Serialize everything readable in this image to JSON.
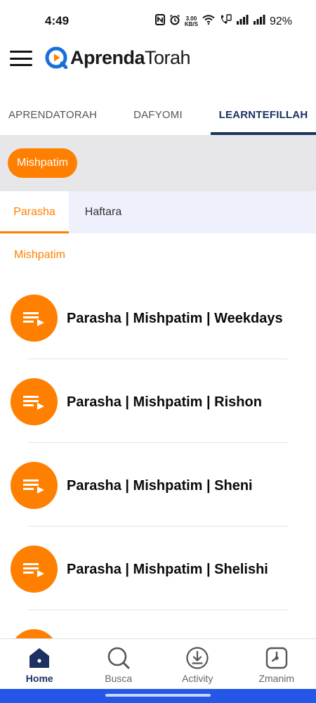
{
  "status_bar": {
    "time": "4:49",
    "net_speed_value": "3.00",
    "net_speed_unit": "KB/S",
    "battery": "92%"
  },
  "header": {
    "logo_bold": "Aprenda",
    "logo_light": "Torah",
    "brand_color": "#1a6fd6"
  },
  "top_tabs": [
    {
      "label": "APRENDATORAH",
      "active": false
    },
    {
      "label": "DAFYOMI",
      "active": false
    },
    {
      "label": "LEARNTEFILLAH",
      "active": true
    }
  ],
  "chip": {
    "label": "Mishpatim"
  },
  "sub_tabs": [
    {
      "label": "Parasha",
      "active": true
    },
    {
      "label": "Haftara",
      "active": false
    }
  ],
  "section_label": "Mishpatim",
  "items": [
    {
      "title": "Parasha | Mishpatim | Weekdays",
      "icon": "playlist-play-icon"
    },
    {
      "title": "Parasha | Mishpatim | Rishon",
      "icon": "playlist-play-icon"
    },
    {
      "title": "Parasha | Mishpatim | Sheni",
      "icon": "playlist-play-icon"
    },
    {
      "title": "Parasha | Mishpatim | Shelishi",
      "icon": "playlist-play-icon"
    },
    {
      "title": "",
      "icon": "playlist-play-icon"
    }
  ],
  "bottom_nav": [
    {
      "label": "Home",
      "icon": "home-icon",
      "active": true
    },
    {
      "label": "Busca",
      "icon": "search-icon",
      "active": false
    },
    {
      "label": "Activity",
      "icon": "download-icon",
      "active": false
    },
    {
      "label": "Zmanim",
      "icon": "clock-icon",
      "active": false
    }
  ],
  "colors": {
    "accent": "#ff7f00",
    "primary": "#1d3263",
    "chip_bar_bg": "#e7e7ea",
    "sub_tabs_bg": "#eef1fb"
  }
}
